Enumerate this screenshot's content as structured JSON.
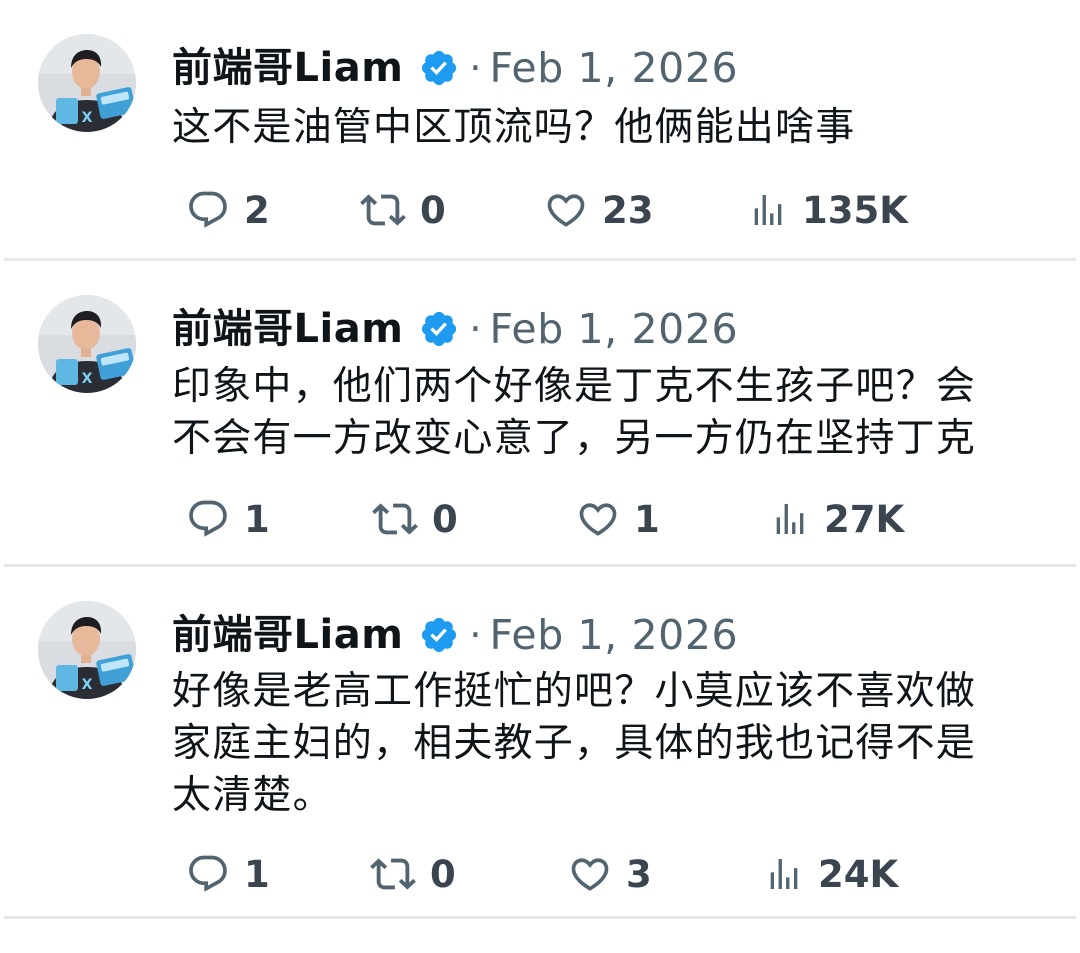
{
  "colors": {
    "text": "#0f1419",
    "muted": "#536471",
    "verified": "#1d9bf0",
    "divider": "#e6e9eb"
  },
  "posts": [
    {
      "author": "前端哥Liam",
      "separator": "·",
      "date": "Feb 1, 2026",
      "text": "这不是油管中区顶流吗？他俩能出啥事",
      "replies": "2",
      "reposts": "0",
      "likes": "23",
      "views": "135K"
    },
    {
      "author": "前端哥Liam",
      "separator": "·",
      "date": "Feb 1, 2026",
      "text": "印象中，他们两个好像是丁克不生孩子吧？会\n不会有一方改变心意了，另一方仍在坚持丁克",
      "replies": "1",
      "reposts": "0",
      "likes": "1",
      "views": "27K"
    },
    {
      "author": "前端哥Liam",
      "separator": "·",
      "date": "Feb 1, 2026",
      "text": "好像是老高工作挺忙的吧？小莫应该不喜欢做\n家庭主妇的，相夫教子，具体的我也记得不是\n太清楚。",
      "replies": "1",
      "reposts": "0",
      "likes": "3",
      "views": "24K"
    }
  ]
}
